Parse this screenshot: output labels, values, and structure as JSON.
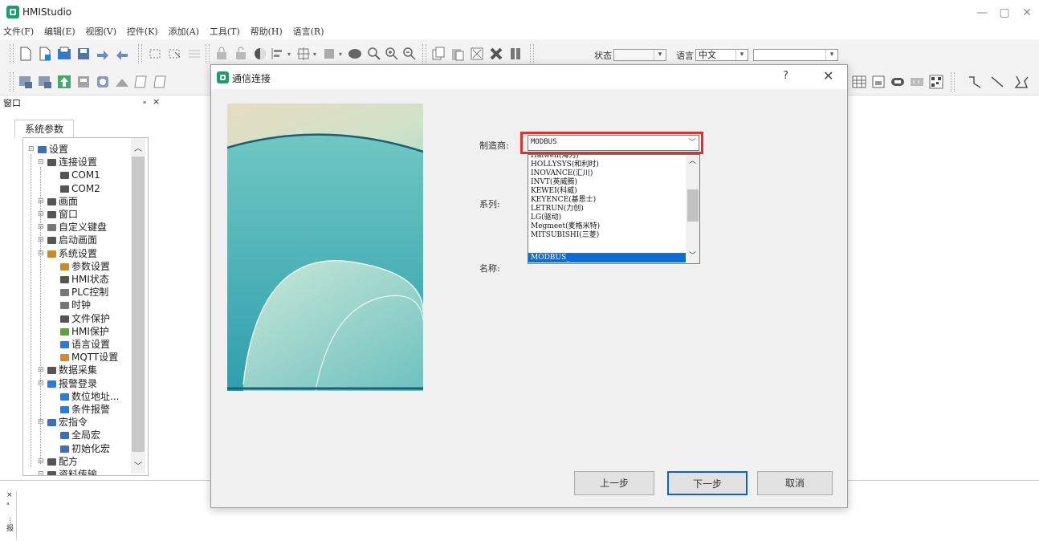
{
  "app": {
    "title": "HMIStudio"
  },
  "window_controls": {
    "minimize": "—",
    "maximize": "▢",
    "close": "✕"
  },
  "menu": [
    "文件(F)",
    "编辑(E)",
    "视图(V)",
    "控件(K)",
    "添加(A)",
    "工具(T)",
    "帮助(H)",
    "语言(R)"
  ],
  "toolbar": {
    "status_label": "状态",
    "language_label": "语言",
    "language_value": "中文",
    "extra_combo_value": ""
  },
  "panel": {
    "title": "窗口",
    "pin": "ₔ",
    "close": "×",
    "tab": "系统参数",
    "tree": [
      {
        "label": "设置",
        "level": 0,
        "icon": "screen-icon",
        "color": "#3d6fb5"
      },
      {
        "label": "连接设置",
        "level": 1,
        "icon": "connection-icon",
        "color": "#555555"
      },
      {
        "label": "COM1",
        "level": 2,
        "icon": "port-icon",
        "color": "#555555"
      },
      {
        "label": "COM2",
        "level": 2,
        "icon": "port-icon",
        "color": "#555555"
      },
      {
        "label": "画面",
        "level": 1,
        "icon": "screens-icon",
        "color": "#555555"
      },
      {
        "label": "窗口",
        "level": 1,
        "icon": "window-icon",
        "color": "#555555"
      },
      {
        "label": "自定义键盘",
        "level": 1,
        "icon": "keyboard-icon",
        "color": "#777777"
      },
      {
        "label": "启动画面",
        "level": 1,
        "icon": "startup-icon",
        "color": "#555555"
      },
      {
        "label": "系统设置",
        "level": 1,
        "icon": "system-icon",
        "color": "#c98a2e"
      },
      {
        "label": "参数设置",
        "level": 2,
        "icon": "params-icon",
        "color": "#c98a2e"
      },
      {
        "label": "HMI状态",
        "level": 2,
        "icon": "hmi-status-icon",
        "color": "#555555"
      },
      {
        "label": "PLC控制",
        "level": 2,
        "icon": "plc-icon",
        "color": "#777777"
      },
      {
        "label": "时钟",
        "level": 2,
        "icon": "clock-icon",
        "color": "#777777"
      },
      {
        "label": "文件保护",
        "level": 2,
        "icon": "lock-icon",
        "color": "#555555"
      },
      {
        "label": "HMI保护",
        "level": 2,
        "icon": "shield-icon",
        "color": "#5aa33a"
      },
      {
        "label": "语言设置",
        "level": 2,
        "icon": "language-icon",
        "color": "#2e7bd6"
      },
      {
        "label": "MQTT设置",
        "level": 2,
        "icon": "mqtt-icon",
        "color": "#d68a2e"
      },
      {
        "label": "数据采集",
        "level": 1,
        "icon": "data-collect-icon",
        "color": "#555555"
      },
      {
        "label": "报警登录",
        "level": 1,
        "icon": "alarm-icon",
        "color": "#2e7bd6"
      },
      {
        "label": "数位地址...",
        "level": 2,
        "icon": "alarm-bit-icon",
        "color": "#2e7bd6"
      },
      {
        "label": "条件报警",
        "level": 2,
        "icon": "alarm-condition-icon",
        "color": "#2e7bd6"
      },
      {
        "label": "宏指令",
        "level": 1,
        "icon": "macro-icon",
        "color": "#3d6fb5"
      },
      {
        "label": "全局宏",
        "level": 2,
        "icon": "global-macro-icon",
        "color": "#3d6fb5"
      },
      {
        "label": "初始化宏",
        "level": 2,
        "icon": "init-macro-icon",
        "color": "#3d6fb5"
      },
      {
        "label": "配方",
        "level": 1,
        "icon": "recipe-icon",
        "color": "#555555"
      },
      {
        "label": "资料传输",
        "level": 1,
        "icon": "transfer-icon",
        "color": "#555555"
      }
    ]
  },
  "bottom_panel": {
    "close": "×",
    "pin": "ₔ",
    "dots": "⋮",
    "label": "报"
  },
  "dialog": {
    "title": "通信连接",
    "help": "?",
    "close": "✕",
    "manufacturer_label": "制造商:",
    "series_label": "系列:",
    "name_label": "名称:",
    "manufacturer_value": "MODBUS",
    "dropdown_options": [
      "Haiwell(海为)",
      "HOLLYSYS(和利时)",
      "INOVANCE(汇川)",
      "INVT(英威腾)",
      "KEWEI(科威)",
      "KEYENCE(基恩士)",
      "LETRUN(力创)",
      "LG(驱动)",
      "Megmeet(麦格米特)",
      "MITSUBISHI(三菱)",
      "MODBUS_"
    ],
    "selected_option": "MODBUS_",
    "buttons": {
      "prev": "上一步",
      "next": "下一步",
      "cancel": "取消"
    }
  }
}
